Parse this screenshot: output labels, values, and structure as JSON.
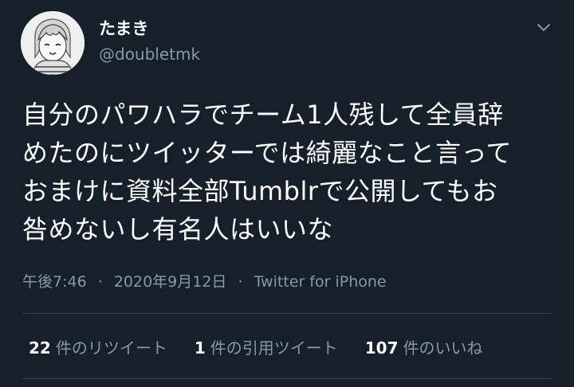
{
  "user": {
    "display_name": "たまき",
    "handle": "@doubletmk",
    "avatar_icon": "user-avatar-drawing"
  },
  "menu_icon": "chevron-down-icon",
  "tweet": {
    "lines": [
      "自分のパワハラでチーム1人残して全員辞",
      "めたのにツイッターでは綺麗なこと言って",
      "おまけに資料全部Tumblrで公開してもお",
      "咎めないし有名人はいいな"
    ],
    "time": "午後7:46",
    "date": "2020年9月12日",
    "separator": "·",
    "source": "Twitter for iPhone"
  },
  "stats": {
    "retweets": {
      "count": "22",
      "label": "件のリツイート"
    },
    "quotes": {
      "count": "1",
      "label": "件の引用ツイート"
    },
    "likes": {
      "count": "107",
      "label": "件のいいね"
    }
  },
  "colors": {
    "background": "#15202b",
    "text_primary": "#ffffff",
    "text_secondary": "#8899a6",
    "divider": "#38444d"
  }
}
